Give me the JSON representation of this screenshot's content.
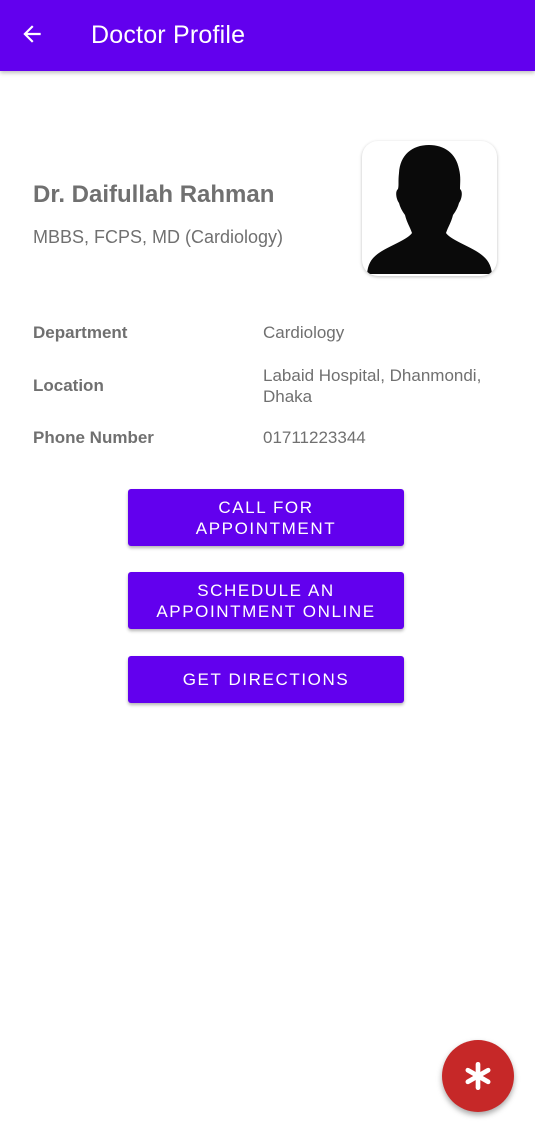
{
  "app_bar": {
    "title": "Doctor Profile",
    "back_icon": "arrow-left-icon",
    "color": "#6200ee"
  },
  "profile": {
    "name": "Dr. Daifullah Rahman",
    "degrees": "MBBS, FCPS, MD (Cardiology)",
    "avatar_icon": "person-silhouette-icon"
  },
  "details": [
    {
      "label": "Department",
      "value": "Cardiology"
    },
    {
      "label": "Location",
      "value": "Labaid Hospital, Dhanmondi, Dhaka"
    },
    {
      "label": "Phone Number",
      "value": "01711223344"
    }
  ],
  "actions": {
    "call": "CALL FOR\nAPPOINTMENT",
    "schedule": "SCHEDULE AN\nAPPOINTMENT ONLINE",
    "directions": "GET DIRECTIONS"
  },
  "fab": {
    "icon": "asterisk-icon",
    "color": "#c62828"
  }
}
